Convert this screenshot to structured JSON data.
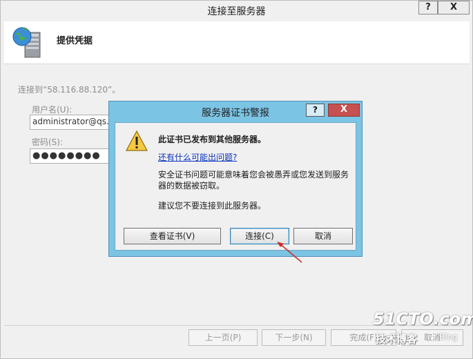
{
  "window": {
    "title": "连接至服务器",
    "help_label": "?",
    "close_label": "X",
    "header_title": "提供凭据",
    "connect_to_text": "连接到“58.116.88.120”。",
    "username_label": "用户名(U):",
    "username_value": "administrator@qs.c",
    "password_label": "密码(S):",
    "password_value": "●●●●●●●●",
    "footer": {
      "prev_label": "上一页(P)",
      "next_label": "下一步(N)",
      "finish_label": "完成(F)",
      "cancel_label": "取消"
    }
  },
  "dialog": {
    "title": "服务器证书警报",
    "help_label": "?",
    "close_label": "X",
    "message_heading": "此证书已发布到其他服务器。",
    "link_text": "还有什么可能出问题?",
    "message_body": "安全证书问题可能意味着您会被愚弄或您发送到服务器的数据被窃取。",
    "advice": "建议您不要连接到此服务器。",
    "buttons": {
      "view_cert": "查看证书(V)",
      "connect": "连接(C)",
      "cancel": "取消"
    }
  },
  "watermark": {
    "site": "51CTO.com",
    "subtitle": "技术博客",
    "blog": "Blog"
  }
}
